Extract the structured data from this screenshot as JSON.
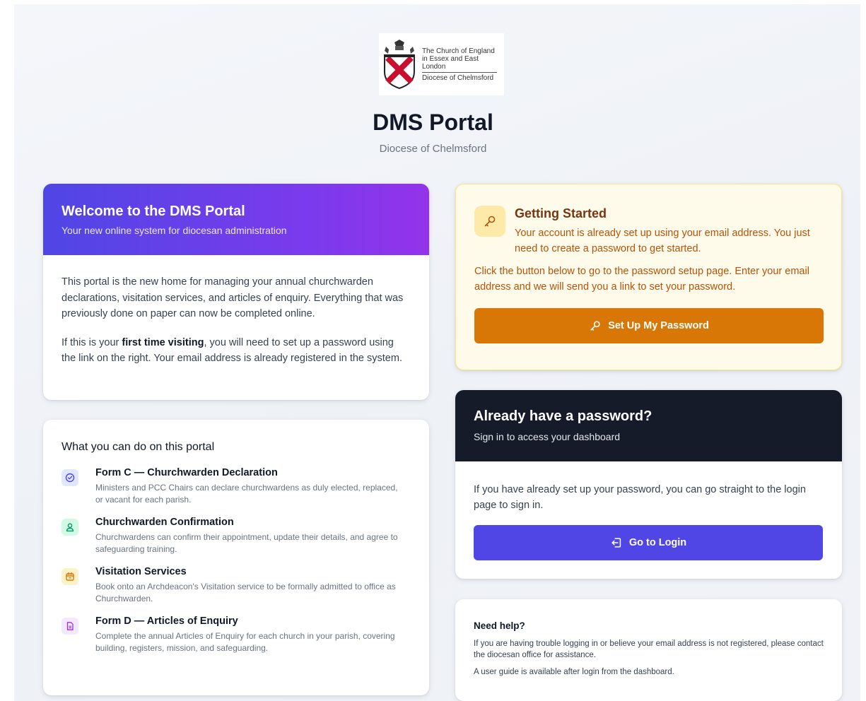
{
  "header": {
    "logo": {
      "line1": "The Church of England",
      "line2": "in Essex and East London",
      "line3": "Diocese of Chelmsford"
    },
    "title": "DMS Portal",
    "subtitle": "Diocese of Chelmsford"
  },
  "welcome": {
    "title": "Welcome to the DMS Portal",
    "subtitle": "Your new online system for diocesan administration",
    "paragraph1": "This portal is the new home for managing your annual churchwarden declarations, visitation services, and articles of enquiry. Everything that was previously done on paper can now be completed online.",
    "paragraph2_before": "If this is your ",
    "paragraph2_bold": "first time visiting",
    "paragraph2_after": ", you will need to set up a password using the link on the right. Your email address is already registered in the system."
  },
  "features": {
    "heading": "What you can do on this portal",
    "items": [
      {
        "title": "Form C — Churchwarden Declaration",
        "description": "Ministers and PCC Chairs can declare churchwardens as duly elected, replaced, or vacant for each parish.",
        "icon": "check-circle-icon",
        "color": "#4f46e5",
        "bg": "#e0e7ff"
      },
      {
        "title": "Churchwarden Confirmation",
        "description": "Churchwardens can confirm their appointment, update their details, and agree to safeguarding training.",
        "icon": "user-icon",
        "color": "#059669",
        "bg": "#d1fae5"
      },
      {
        "title": "Visitation Services",
        "description": "Book onto an Archdeacon's Visitation service to be formally admitted to office as Churchwarden.",
        "icon": "calendar-icon",
        "color": "#d97706",
        "bg": "#fef3c7"
      },
      {
        "title": "Form D — Articles of Enquiry",
        "description": "Complete the annual Articles of Enquiry for each church in your parish, covering building, registers, mission, and safeguarding.",
        "icon": "document-icon",
        "color": "#9333ea",
        "bg": "#f3e8ff"
      }
    ]
  },
  "getting_started": {
    "title": "Getting Started",
    "lead": "Your account is already set up using your email address. You just need to create a password to get started.",
    "info": "Click the button below to go to the password setup page. Enter your email address and we will send you a link to set your password.",
    "button_label": "Set Up My Password",
    "icon": "key-icon"
  },
  "login": {
    "title": "Already have a password?",
    "subtitle": "Sign in to access your dashboard",
    "body": "If you have already set up your password, you can go straight to the login page to sign in.",
    "button_label": "Go to Login",
    "icon": "login-icon"
  },
  "help": {
    "title": "Need help?",
    "paragraph1": "If you are having trouble logging in or believe your email address is not registered, please contact the diocesan office for assistance.",
    "paragraph2": "A user guide is available after login from the dashboard."
  },
  "colors": {
    "primary": "#4f46e5",
    "accent": "#d97706",
    "dark": "#151b29"
  }
}
